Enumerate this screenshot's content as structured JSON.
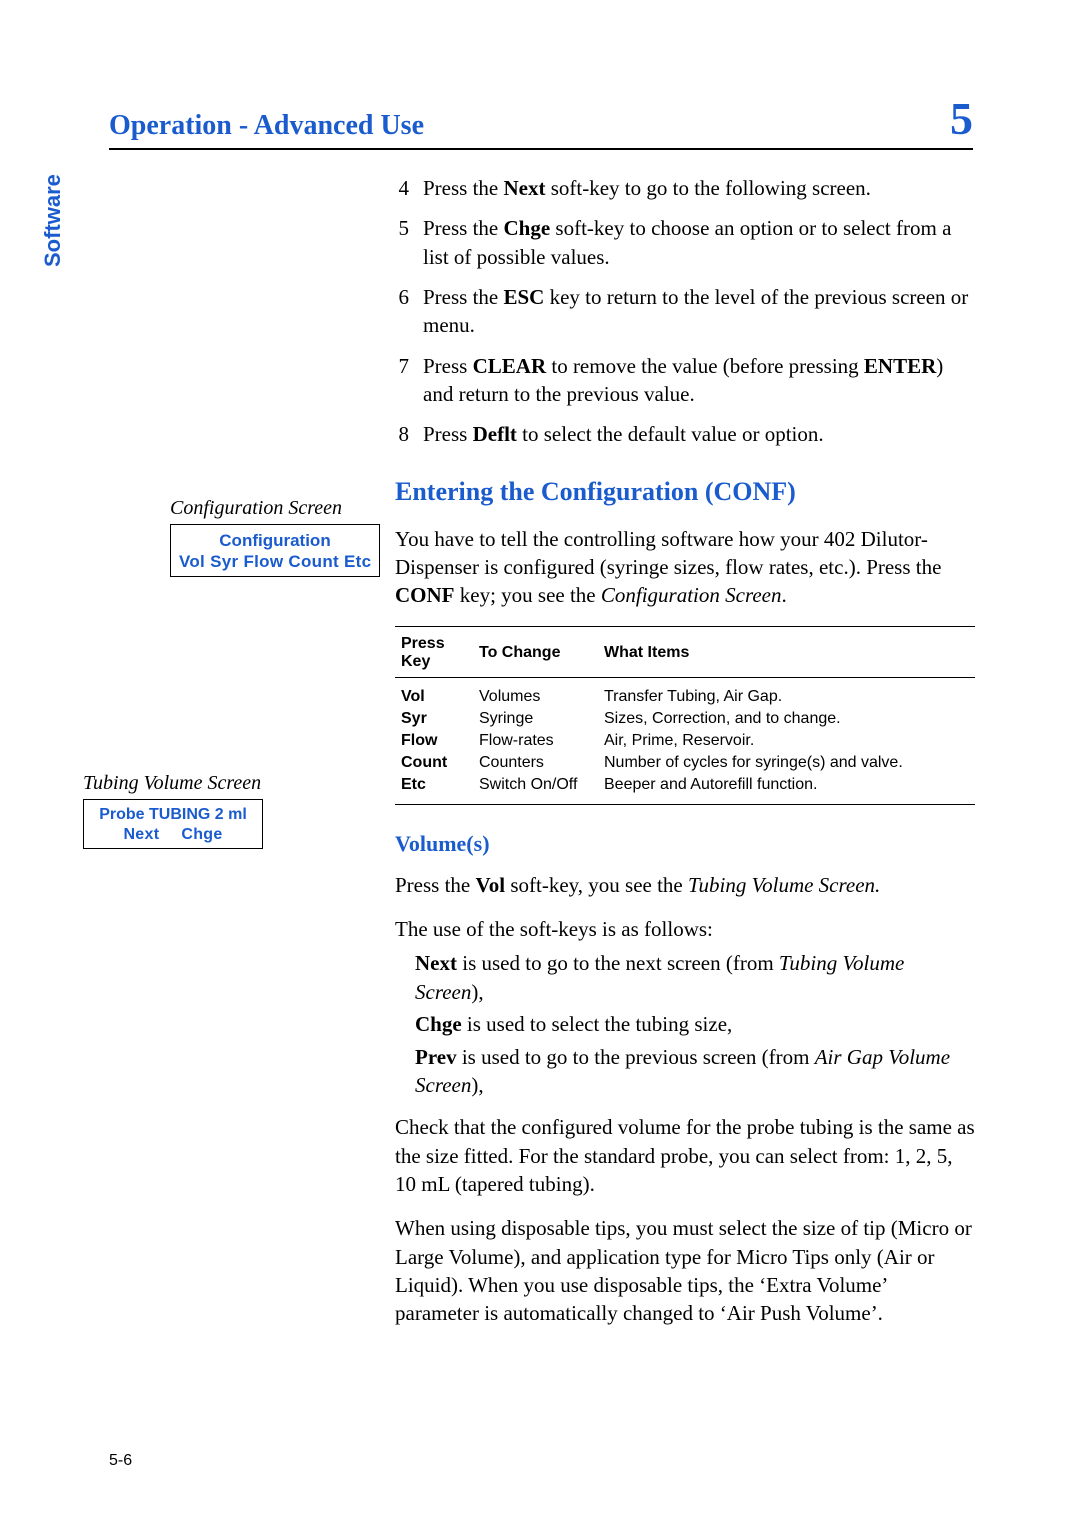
{
  "header": {
    "title": "Operation - Advanced Use",
    "chapter": "5"
  },
  "side_tab": "Software",
  "steps": [
    {
      "n": "4",
      "pre": "Press the ",
      "key": "Next",
      "post": " soft-key to go to the following screen."
    },
    {
      "n": "5",
      "pre": "Press the ",
      "key": "Chge",
      "post": " soft-key to choose an option or to select from a list of possible values."
    },
    {
      "n": "6",
      "pre": "Press the ",
      "key": "ESC",
      "post": " key to return to the level of the previous screen or menu."
    },
    {
      "n": "7",
      "pre": "Press ",
      "key": "CLEAR",
      "mid": " to remove the value (before pressing ",
      "key2": "ENTER",
      "post": ") and return to the previous value."
    },
    {
      "n": "8",
      "pre": "Press ",
      "key": "Deflt",
      "post": " to select the default value or option."
    }
  ],
  "h2_conf": "Entering the Configuration (CONF)",
  "conf_para": {
    "a": "You have to tell the controlling software how your 402 Dilutor-Dispenser is configured (syringe sizes, flow rates, etc.). Press the ",
    "key": "CONF",
    "b": " key; you see the ",
    "ital": "Configuration Screen",
    "c": "."
  },
  "fig1": {
    "cap": "Configuration Screen",
    "line1": "Configuration",
    "line2": "Vol  Syr Flow  Count  Etc"
  },
  "table": {
    "h1": "Press Key",
    "h2": "To Change",
    "h3": "What Items",
    "rows": [
      {
        "k": "Vol",
        "c": "Volumes",
        "w": "Transfer Tubing, Air Gap."
      },
      {
        "k": "Syr",
        "c": "Syringe",
        "w": "Sizes, Correction, and to change."
      },
      {
        "k": "Flow",
        "c": "Flow-rates",
        "w": "Air, Prime, Reservoir."
      },
      {
        "k": "Count",
        "c": "Counters",
        "w": "Number of cycles for syringe(s) and valve."
      },
      {
        "k": "Etc",
        "c": "Switch On/Off",
        "w": "Beeper and Autorefill function."
      }
    ]
  },
  "fig2": {
    "cap": "Tubing Volume Screen",
    "line1": "Probe TUBING 2 ml",
    "k1": "Next",
    "k2": "Chge"
  },
  "h3_vol": "Volume(s)",
  "vol_intro": {
    "a": "Press the ",
    "key": "Vol",
    "b": " soft-key, you see the ",
    "ital": "Tubing Volume Screen.",
    "c": ""
  },
  "vol_line": "The use of the soft-keys is as follows:",
  "vol_items": [
    {
      "key": "Next",
      "a": " is used to go to the next screen (from ",
      "ital": "Tubing Volume Screen",
      "b": "),"
    },
    {
      "key": "Chge",
      "a": " is used to select the tubing size,",
      "ital": "",
      "b": ""
    },
    {
      "key": "Prev",
      "a": " is used to go to the previous screen (from ",
      "ital": "Air Gap Volume Screen",
      "b": "),"
    }
  ],
  "vol_p1": "Check that the configured volume for the probe tubing is the same as the size fitted. For the standard probe, you can select from: 1, 2, 5, 10 mL (tapered tubing).",
  "vol_p2": "When using disposable tips, you must select the size of tip (Micro or Large Volume), and application type for Micro Tips only (Air or Liquid). When you use disposable tips, the ‘Extra Volume’ parameter is automatically changed to ‘Air Push Volume’.",
  "footer": "5-6"
}
